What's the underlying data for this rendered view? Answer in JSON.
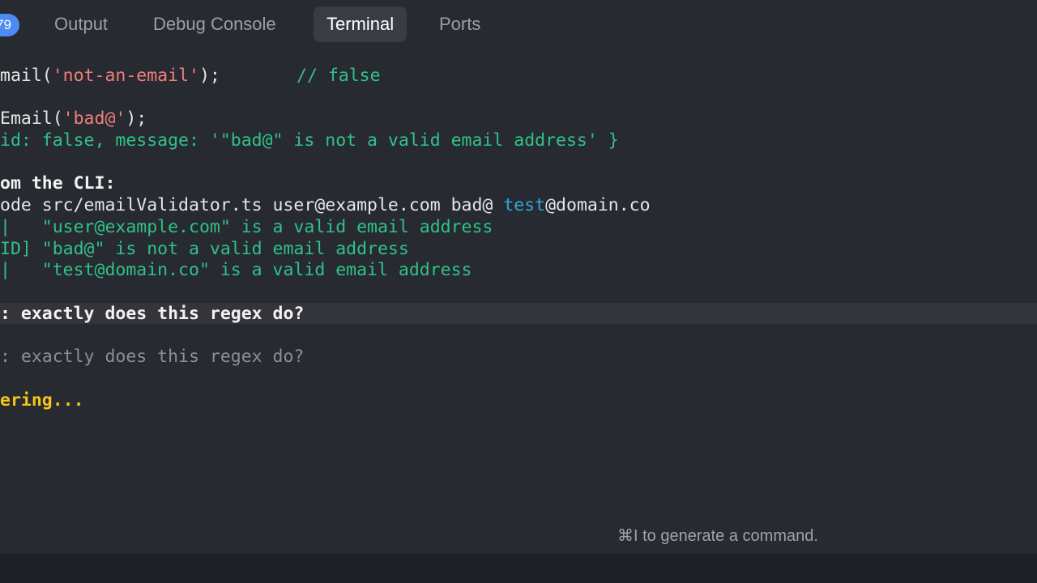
{
  "tabs": {
    "badge_count": "79",
    "output": "Output",
    "debug_console": "Debug Console",
    "terminal": "Terminal",
    "ports": "Ports"
  },
  "terminal": {
    "l1_a": "mail(",
    "l1_b": "'not-an-email'",
    "l1_c": ");",
    "l1_comment": "// false",
    "l2_a": "Email(",
    "l2_b": "'bad@'",
    "l2_c": ");",
    "l3": "id: false, message: '\"bad@\" is not a valid email address' }",
    "l4": "om the CLI:",
    "l5_a": "ode src/emailValidator.ts user@example.com bad@ ",
    "l5_b": "test",
    "l5_c": "@domain.co",
    "l6": "|   \"user@example.com\" is a valid email address",
    "l7": "ID] \"bad@\" is not a valid email address",
    "l8": "|   \"test@domain.co\" is a valid email address",
    "l9": ": exactly does this regex do?",
    "l10": ": exactly does this regex do?",
    "l11": "ering..."
  },
  "hint": "⌘I to generate a command."
}
